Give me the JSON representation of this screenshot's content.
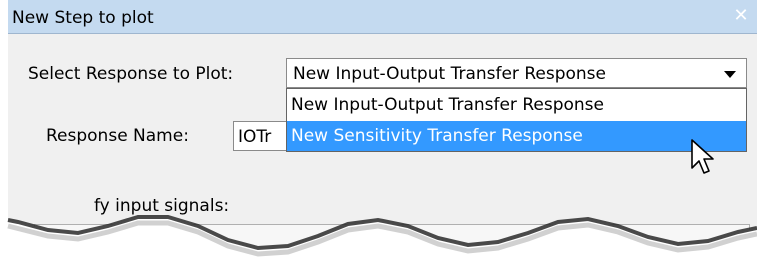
{
  "dialog": {
    "title": "New Step to plot",
    "close_glyph": "✕"
  },
  "form": {
    "select_label": "Select Response to Plot:",
    "select_value": "New Input-Output Transfer Response",
    "name_label": "Response Name:",
    "name_value": "IOTr",
    "signals_label": "fy input signals:"
  },
  "dropdown": {
    "options": [
      "New Input-Output Transfer Response",
      "New Sensitivity Transfer Response"
    ],
    "highlighted_index": 1
  },
  "colors": {
    "titlebar": "#c4daf0",
    "highlight": "#3399ff",
    "dialog_bg": "#f0f0f0"
  },
  "icons": {
    "close": "close-icon",
    "arrow": "chevron-down-icon",
    "pointer": "mouse-pointer-icon"
  }
}
